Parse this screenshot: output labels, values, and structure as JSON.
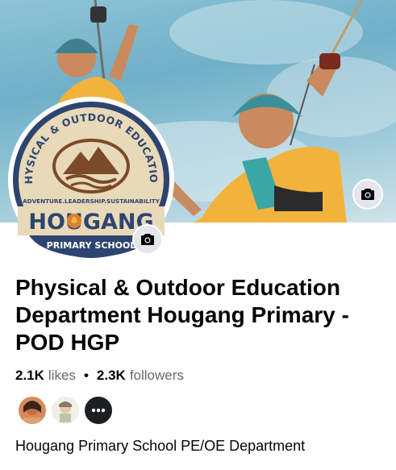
{
  "cover": {
    "camera_icon": "camera-icon"
  },
  "logo": {
    "arc_text": "PHYSICAL & OUTDOOR EDUCATION",
    "motto": "ADVENTURE.LEADERSHIP.SUSTAINABILITY",
    "school_name": "HOUGANG",
    "subtitle": "PRIMARY SCHOOL"
  },
  "page": {
    "name": "Physical & Outdoor Education Department Hougang Primary - POD HGP",
    "likes_count": "2.1K",
    "likes_label": "likes",
    "followers_count": "2.3K",
    "followers_label": "followers",
    "separator": "•",
    "description": "Hougang Primary School PE/OE Department"
  },
  "friends": {
    "more_icon": "more-dots-icon"
  },
  "colors": {
    "logo_navy": "#2e4470",
    "logo_tan": "#e8d9b8",
    "logo_orange": "#d9822b",
    "accent_yellow": "#f2b33d"
  }
}
